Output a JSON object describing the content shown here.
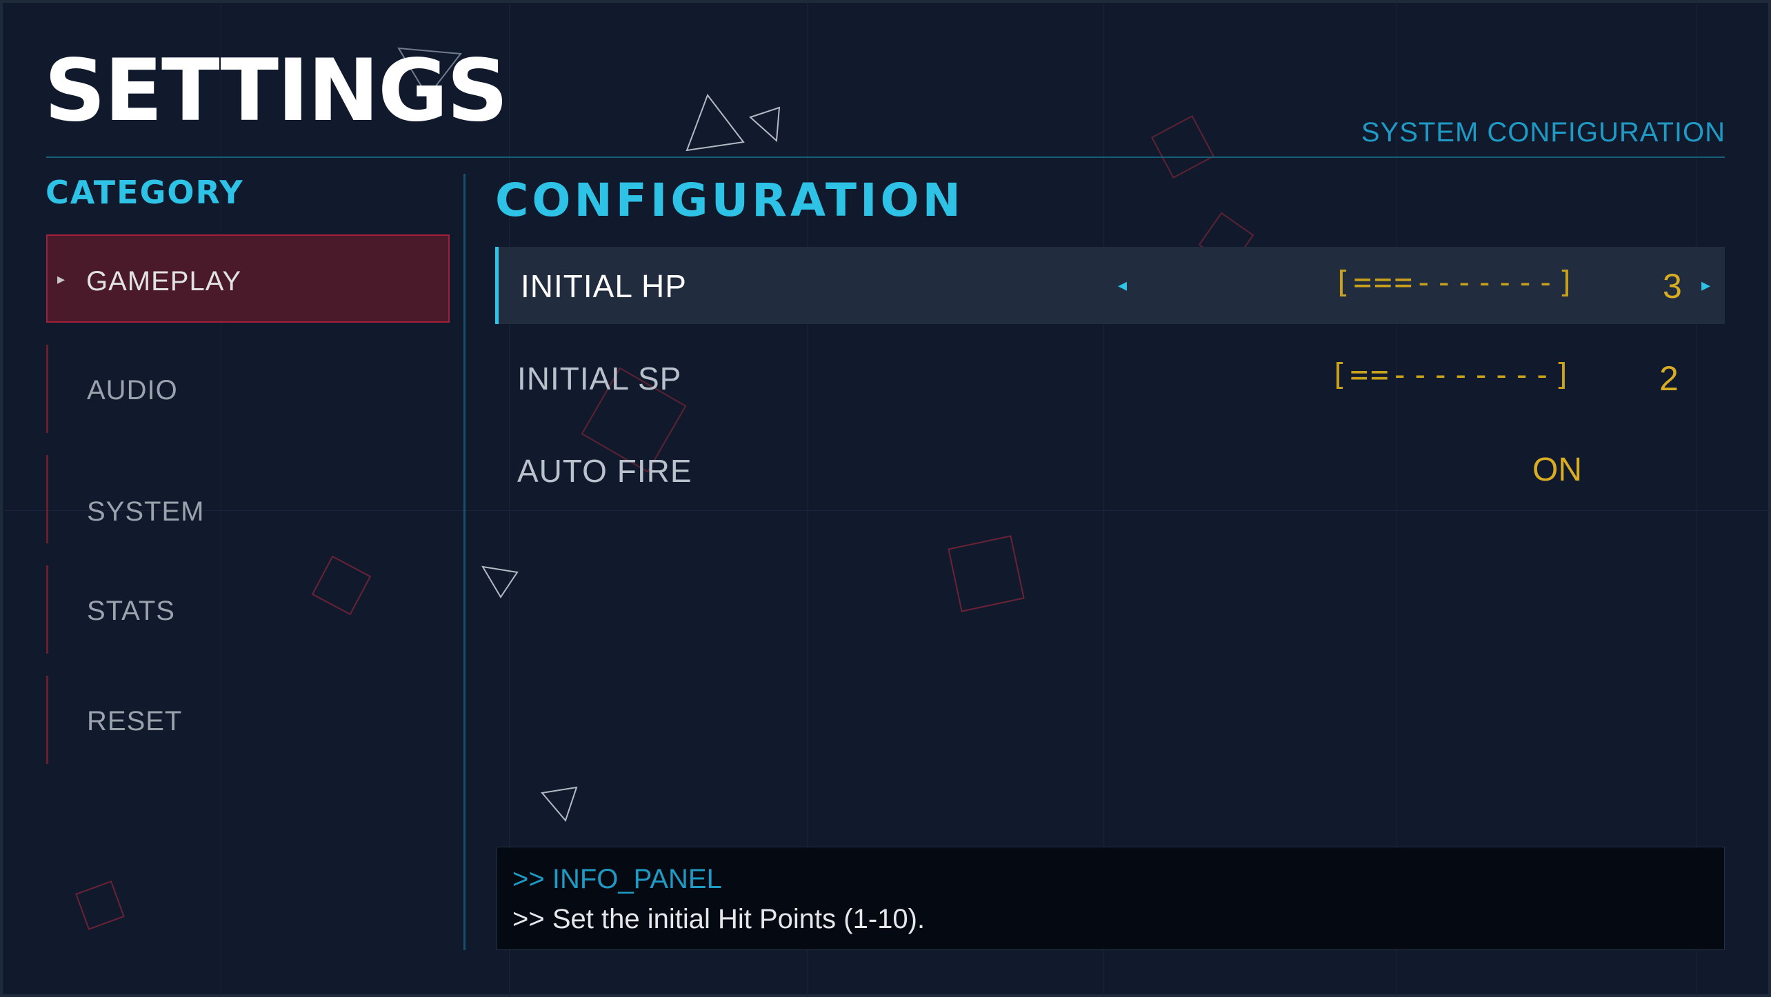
{
  "header": {
    "title": "SETTINGS",
    "subtitle": "SYSTEM CONFIGURATION"
  },
  "sidebar": {
    "heading": "CATEGORY",
    "selected_marker": "▸",
    "items": [
      {
        "label": "GAMEPLAY",
        "active": true
      },
      {
        "label": "AUDIO",
        "active": false
      },
      {
        "label": "SYSTEM",
        "active": false
      },
      {
        "label": "STATS",
        "active": false
      },
      {
        "label": "RESET",
        "active": false
      }
    ]
  },
  "config": {
    "heading": "CONFIGURATION",
    "rows": [
      {
        "label": "INITIAL HP",
        "selected": true,
        "bar": "[===-------]",
        "value": "3",
        "min": 1,
        "max": 10,
        "arrow_left": "◂",
        "arrow_right": "▸"
      },
      {
        "label": "INITIAL SP",
        "selected": false,
        "bar": "[==--------]",
        "value": "2"
      },
      {
        "label": "AUTO FIRE",
        "selected": false,
        "toggle": "ON"
      }
    ]
  },
  "info_panel": {
    "title": ">> INFO_PANEL",
    "text": ">> Set the initial Hit Points (1-10)."
  },
  "colors": {
    "background": "#111a2c",
    "accent_cyan": "#2ec3e6",
    "accent_gold": "#d9ad23",
    "active_red": "#a01f3a",
    "title": "#ffffff"
  }
}
